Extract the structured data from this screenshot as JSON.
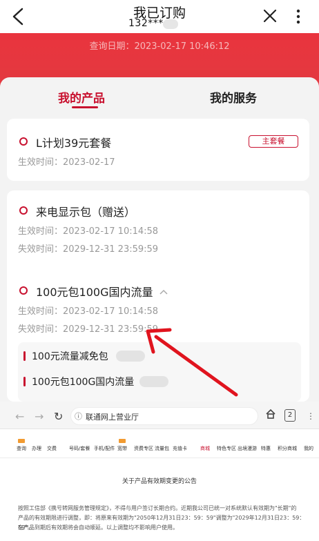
{
  "header": {
    "title": "我已订购",
    "phone_masked": "132***"
  },
  "banner": {
    "query_date": "查询日期：2023-02-17 10:46:12"
  },
  "tabs": [
    {
      "label": "我的产品",
      "active": true
    },
    {
      "label": "我的服务",
      "active": false
    }
  ],
  "products": [
    {
      "name": "L计划39元套餐",
      "badge": "主套餐",
      "effective": "生效时间：2023-02-17"
    },
    {
      "name": "来电显示包（赠送）",
      "effective": "生效时间：2023-02-17 10:14:58",
      "expiry": "失效时间：2029-12-31 23:59:59"
    },
    {
      "name": "100元包100G国内流量",
      "effective": "生效时间：2023-02-17 10:14:58",
      "expiry": "失效时间：2029-12-31 23:59:59",
      "sub_items": [
        "100元流量减免包",
        "100元包100G国内流量"
      ]
    }
  ],
  "browser": {
    "url_text": "联通网上营业厅",
    "tab_count": "2",
    "menu": [
      "查询",
      "办理",
      "交费",
      "号码/套餐",
      "手机/配件",
      "宽带",
      "资费专区",
      "流量包",
      "充值卡",
      "商城",
      "特色专区",
      "出境漫游",
      "特惠",
      "积分商城",
      "我的"
    ],
    "notice_title": "关于产品有效期变更的公告",
    "notice_lines": [
      "按照工信部《携号转网服务管理规定》，不得与用户签订长期合约。近期我公司已统一对系统默认有效期为\"长期\"的",
      "产品的有效期限进行调整，即：将原来有效期为\"2050年12月31日23：59：59\"调整为\"2029年12月31日23：59：59\"。",
      "在产品到期后有效期将会自动顺延。以上调整均不影响用户使用。"
    ]
  },
  "colors": {
    "brand_red": "#c8102e",
    "banner_red": "#e9343e",
    "annotation_arrow": "#e0141e"
  }
}
